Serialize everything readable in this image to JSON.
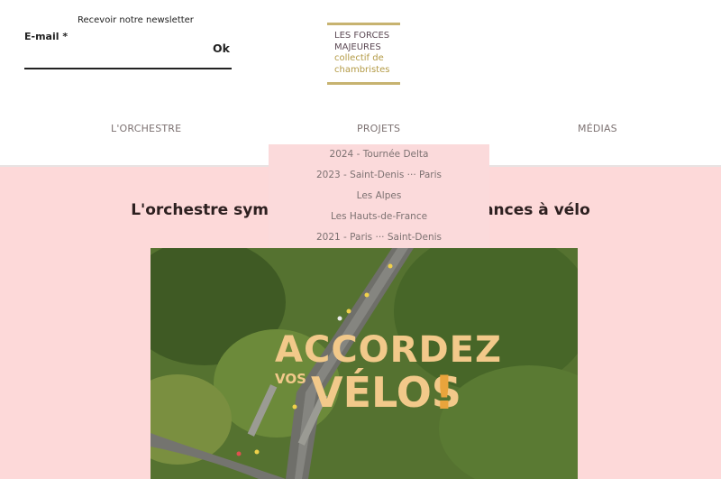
{
  "newsletter": {
    "title": "Recevoir notre newsletter",
    "email_label": "E-mail *",
    "email_value": "",
    "ok_label": "Ok"
  },
  "logo": {
    "line1": "LES FORCES",
    "line2": "MAJEURES",
    "line3": "collectif de",
    "line4": "chambristes"
  },
  "nav": {
    "orchestre": "L'ORCHESTRE",
    "projets": "PROJETS",
    "medias": "MÉDIAS"
  },
  "dropdown": {
    "items": [
      "2024 - Tournée Delta",
      "2023 - Saint-Denis ··· Paris",
      "Les Alpes",
      "Les Hauts-de-France",
      "2021 - Paris ··· Saint-Denis"
    ]
  },
  "main": {
    "headline": "L'orchestre symphonique qui parcourt la France et ses territoires en musique, en vacances à vélo",
    "headline_left": "L'orchestre symp",
    "headline_right": "erances à vélo"
  },
  "hero": {
    "line1": "ACCORDEZ",
    "line2a": "VOS",
    "line2b": "VÉLOS",
    "exclaim": "!"
  },
  "colors": {
    "background_pink": "#fdd9d9",
    "dropdown_pink": "#fbdadb",
    "logo_gold": "#c7b370",
    "hero_title": "#f2c98a",
    "accent_orange": "#e9a43c"
  }
}
